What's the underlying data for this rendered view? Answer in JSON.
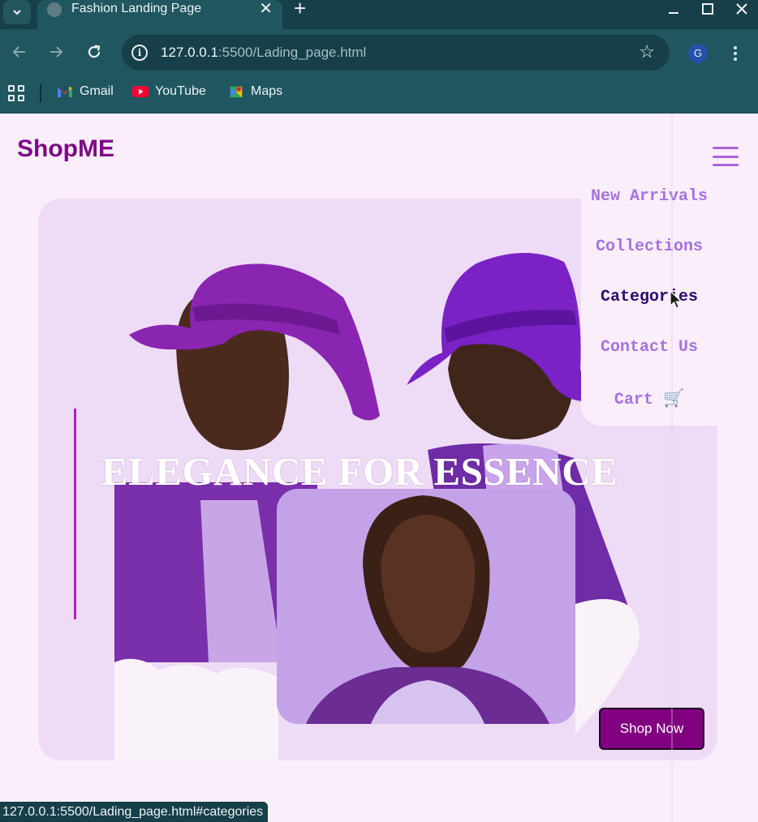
{
  "browser": {
    "tab_title": "Fashion Landing Page",
    "url_host": "127.0.0.1",
    "url_rest": ":5500/Lading_page.html",
    "profile_initial": "G",
    "bookmarks": [
      {
        "label": "Gmail",
        "icon": "gmail-icon"
      },
      {
        "label": "YouTube",
        "icon": "youtube-icon"
      },
      {
        "label": "Maps",
        "icon": "maps-icon"
      }
    ],
    "status_url": "127.0.0.1:5500/Lading_page.html#categories"
  },
  "page": {
    "logo": "ShopME",
    "hero_title": "ELEGANCE FOR ESSENCE",
    "cta_label": "Shop Now",
    "menu": [
      {
        "label": "New Arrivals"
      },
      {
        "label": "Collections"
      },
      {
        "label": "Categories",
        "state": "hovered"
      },
      {
        "label": "Contact Us"
      },
      {
        "label": "Cart",
        "icon": "cart-icon",
        "glyph": "🛒"
      }
    ]
  },
  "colors": {
    "brand": "#800080",
    "logo": "#7d0a84",
    "menu_text": "#a472de",
    "menu_text_active": "#2e0b6e",
    "page_background": "#fbeefb",
    "hero_background": "#eedcf6",
    "browser_chrome": "#1f5660"
  }
}
